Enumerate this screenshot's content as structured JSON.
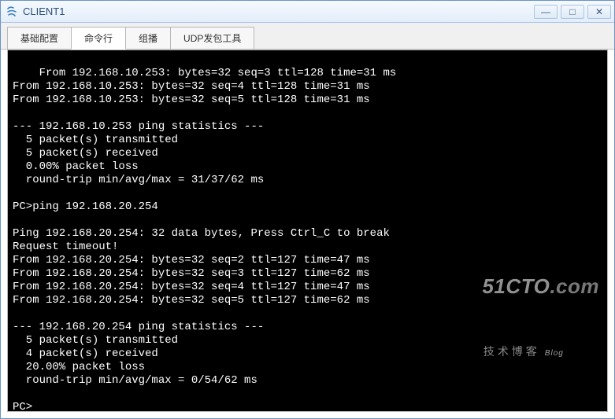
{
  "window": {
    "title": "CLIENT1",
    "controls": {
      "min": "—",
      "max": "□",
      "close": "✕"
    }
  },
  "tabs": [
    {
      "label": "基础配置",
      "active": false
    },
    {
      "label": "命令行",
      "active": true
    },
    {
      "label": "组播",
      "active": false
    },
    {
      "label": "UDP发包工具",
      "active": false
    }
  ],
  "terminal": {
    "lines": [
      "From 192.168.10.253: bytes=32 seq=3 ttl=128 time=31 ms",
      "From 192.168.10.253: bytes=32 seq=4 ttl=128 time=31 ms",
      "From 192.168.10.253: bytes=32 seq=5 ttl=128 time=31 ms",
      "",
      "--- 192.168.10.253 ping statistics ---",
      "  5 packet(s) transmitted",
      "  5 packet(s) received",
      "  0.00% packet loss",
      "  round-trip min/avg/max = 31/37/62 ms",
      "",
      "PC>ping 192.168.20.254",
      "",
      "Ping 192.168.20.254: 32 data bytes, Press Ctrl_C to break",
      "Request timeout!",
      "From 192.168.20.254: bytes=32 seq=2 ttl=127 time=47 ms",
      "From 192.168.20.254: bytes=32 seq=3 ttl=127 time=62 ms",
      "From 192.168.20.254: bytes=32 seq=4 ttl=127 time=47 ms",
      "From 192.168.20.254: bytes=32 seq=5 ttl=127 time=62 ms",
      "",
      "--- 192.168.20.254 ping statistics ---",
      "  5 packet(s) transmitted",
      "  4 packet(s) received",
      "  20.00% packet loss",
      "  round-trip min/avg/max = 0/54/62 ms",
      "",
      "PC>"
    ]
  },
  "watermark": {
    "main_a": "51CTO",
    "main_b": ".com",
    "sub": "技术博客",
    "sub_small": "Blog"
  }
}
